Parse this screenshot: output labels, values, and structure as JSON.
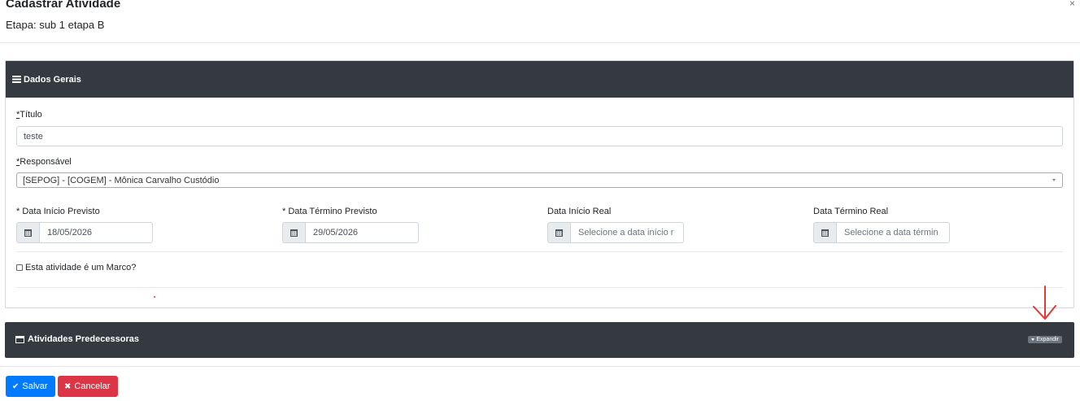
{
  "header": {
    "title": "Cadastrar Atividade",
    "subtitle": "Etapa: sub 1 etapa B",
    "close_glyph": "×"
  },
  "dados_gerais": {
    "title": "Dados Gerais",
    "icon": "bars-icon",
    "titulo": {
      "req": "*",
      "label": "Título",
      "value": "teste"
    },
    "responsavel": {
      "req": "*",
      "label": "Responsável",
      "selected": "[SEPOG] - [COGEM] - Mônica Carvalho Custódio"
    },
    "dates": [
      {
        "label": "* Data Início Previsto",
        "value": "18/05/2026",
        "placeholder": ""
      },
      {
        "label": "* Data Término Previsto",
        "value": "29/05/2026",
        "placeholder": ""
      },
      {
        "label": "Data Início Real",
        "value": "",
        "placeholder": "Selecione a data início r"
      },
      {
        "label": "Data Término Real",
        "value": "",
        "placeholder": "Selecione a data términ"
      }
    ],
    "marco_checkbox": {
      "label": "Esta atividade é um Marco?",
      "checked": false
    }
  },
  "predecessoras": {
    "title": "Atividades Predecessoras",
    "expand_label": "Expandir"
  },
  "footer": {
    "save_label": "Salvar",
    "cancel_label": "Cancelar"
  },
  "colors": {
    "header_bg": "#343a40",
    "primary": "#007bff",
    "danger": "#dc3545",
    "annotation_arrow": "#e53935"
  }
}
